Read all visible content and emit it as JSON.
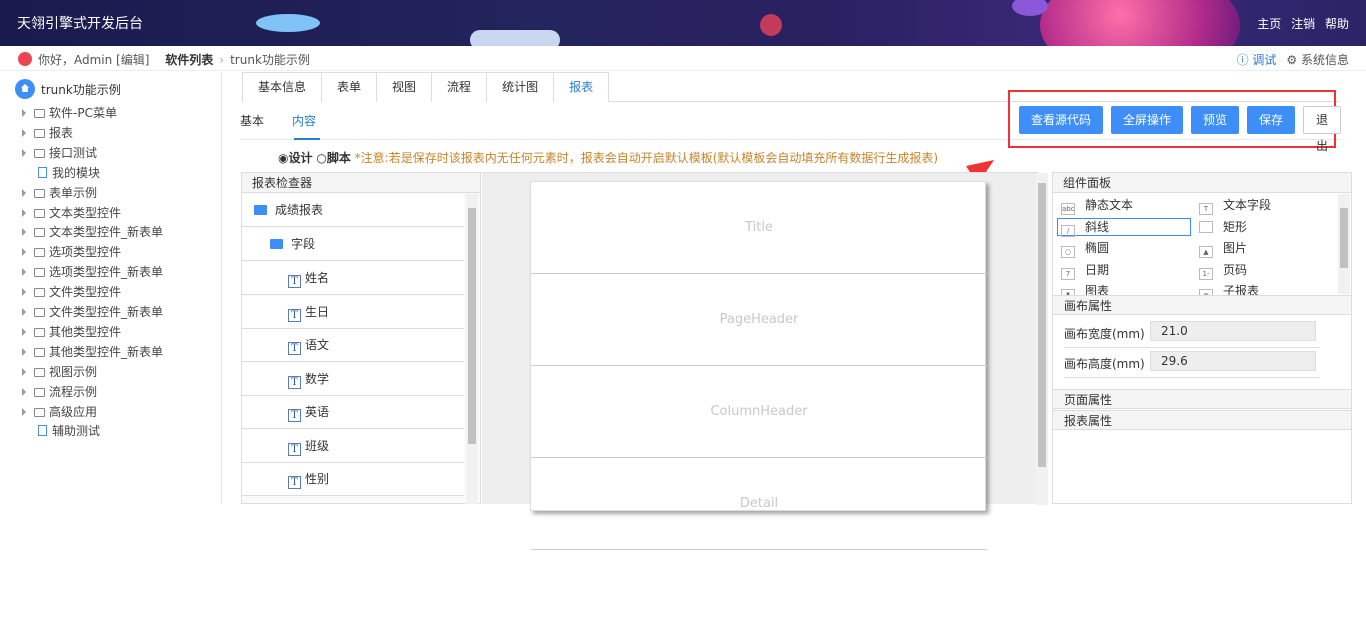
{
  "app": {
    "title": "天翎引擎式开发后台",
    "nav": [
      "主页",
      "注销",
      "帮助"
    ]
  },
  "breadcrumb": {
    "greeting": "你好，Admin [编辑]",
    "section": "软件列表",
    "current": "trunk功能示例",
    "debug": "调试",
    "sysinfo": "系统信息"
  },
  "sidebar": {
    "root": "trunk功能示例",
    "items": [
      {
        "label": "软件-PC菜单",
        "type": "folder"
      },
      {
        "label": "报表",
        "type": "folder"
      },
      {
        "label": "接口测试",
        "type": "folder"
      },
      {
        "label": "我的模块",
        "type": "doc"
      },
      {
        "label": "表单示例",
        "type": "folder"
      },
      {
        "label": "文本类型控件",
        "type": "folder"
      },
      {
        "label": "文本类型控件_新表单",
        "type": "folder"
      },
      {
        "label": "选项类型控件",
        "type": "folder"
      },
      {
        "label": "选项类型控件_新表单",
        "type": "folder"
      },
      {
        "label": "文件类型控件",
        "type": "folder"
      },
      {
        "label": "文件类型控件_新表单",
        "type": "folder"
      },
      {
        "label": "其他类型控件",
        "type": "folder"
      },
      {
        "label": "其他类型控件_新表单",
        "type": "folder"
      },
      {
        "label": "视图示例",
        "type": "folder"
      },
      {
        "label": "流程示例",
        "type": "folder"
      },
      {
        "label": "高级应用",
        "type": "folder"
      },
      {
        "label": "辅助测试",
        "type": "doc"
      }
    ]
  },
  "tabs": [
    {
      "label": "基本信息",
      "active": false
    },
    {
      "label": "表单",
      "active": false
    },
    {
      "label": "视图",
      "active": false
    },
    {
      "label": "流程",
      "active": false
    },
    {
      "label": "统计图",
      "active": false
    },
    {
      "label": "报表",
      "active": true
    }
  ],
  "subtabs": [
    {
      "label": "基本",
      "active": false
    },
    {
      "label": "内容",
      "active": true
    }
  ],
  "mode": {
    "design": "设计",
    "script": "脚本",
    "notice": "*注意:若是保存时该报表内无任何元素时，报表会自动开启默认模板(默认模板会自动填充所有数据行生成报表)"
  },
  "actions": {
    "view_source": "查看源代码",
    "fullscreen": "全屏操作",
    "preview": "预览",
    "save": "保存",
    "exit": "退出"
  },
  "inspector": {
    "title": "报表检查器",
    "root": "成绩报表",
    "folder": "字段",
    "fields": [
      "姓名",
      "生日",
      "语文",
      "数学",
      "英语",
      "班级",
      "性别"
    ]
  },
  "canvas": {
    "bands": [
      "Title",
      "PageHeader",
      "ColumnHeader",
      "Detail"
    ]
  },
  "components": {
    "title": "组件面板",
    "items": [
      {
        "label": "静态文本",
        "icon": "abc-icon"
      },
      {
        "label": "文本字段",
        "icon": "text-field-icon"
      },
      {
        "label": "斜线",
        "icon": "line-icon"
      },
      {
        "label": "矩形",
        "icon": "rectangle-icon"
      },
      {
        "label": "椭圆",
        "icon": "ellipse-icon"
      },
      {
        "label": "图片",
        "icon": "image-icon"
      },
      {
        "label": "日期",
        "icon": "date-icon"
      },
      {
        "label": "页码",
        "icon": "page-number-icon"
      },
      {
        "label": "图表",
        "icon": "chart-icon"
      },
      {
        "label": "子报表",
        "icon": "subreport-icon"
      }
    ],
    "canvas_props_title": "画布属性",
    "width_label": "画布宽度(mm)",
    "width_value": "21.0",
    "height_label": "画布高度(mm)",
    "height_value": "29.6",
    "page_props_title": "页面属性",
    "report_props_title": "报表属性"
  },
  "colors": {
    "accent": "#3e8ef7",
    "highlight_box": "#ee3333",
    "topbar": "#1f1f55"
  }
}
